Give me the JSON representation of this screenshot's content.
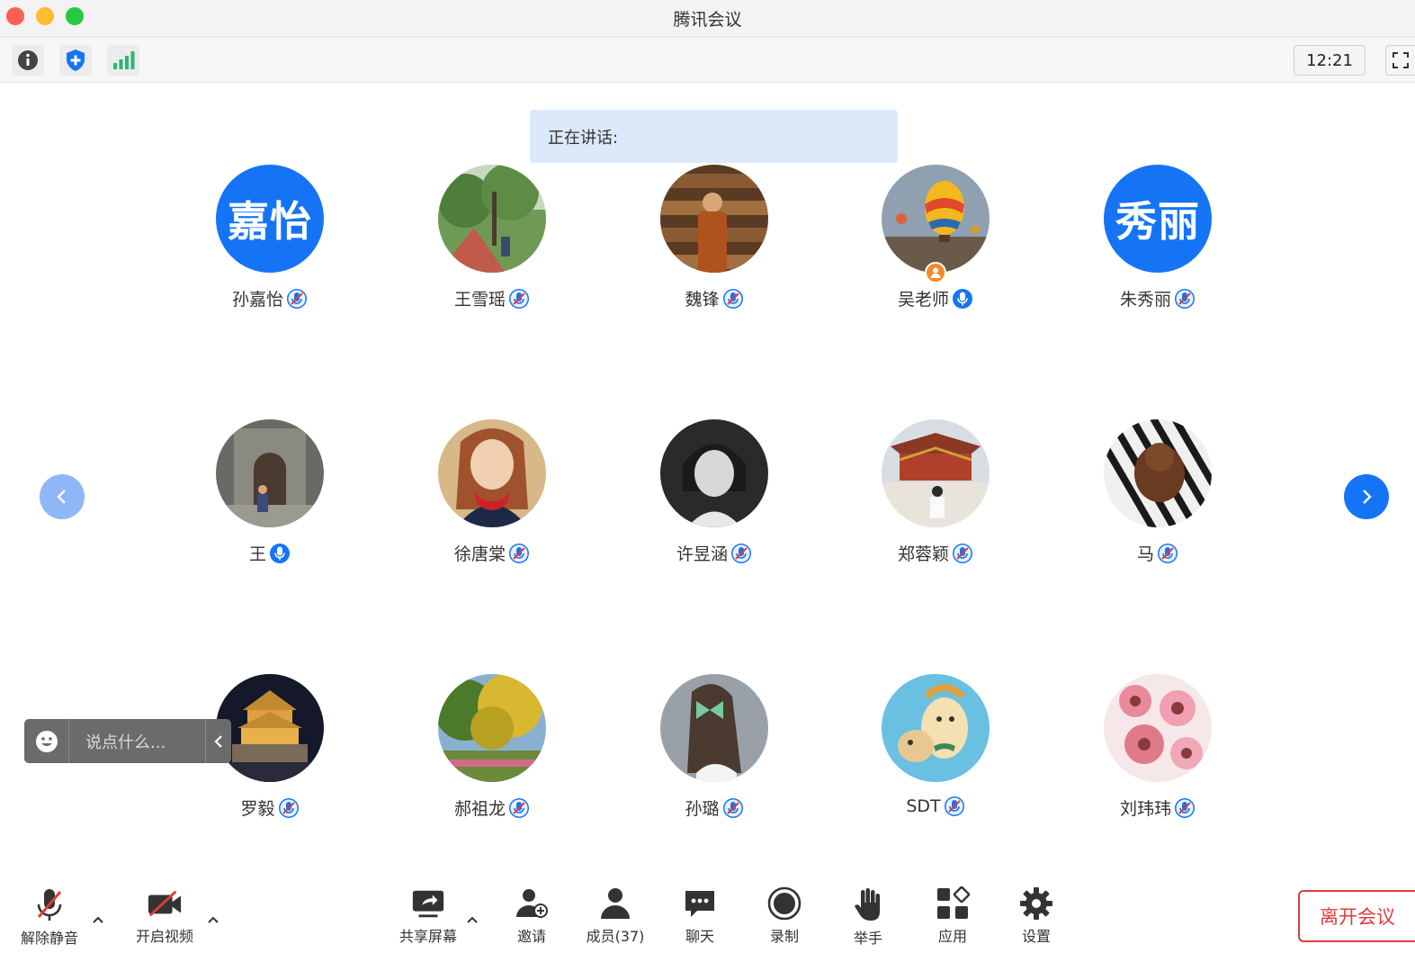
{
  "window": {
    "title": "腾讯会议"
  },
  "infobar": {
    "clock": "12:21"
  },
  "speaking": {
    "label": "正在讲话:"
  },
  "participants": [
    {
      "name": "孙嘉怡",
      "avatar_text": "嘉怡",
      "mic": "muted"
    },
    {
      "name": "王雪瑶",
      "avatar_text": "",
      "mic": "muted"
    },
    {
      "name": "魏锋",
      "avatar_text": "",
      "mic": "muted"
    },
    {
      "name": "吴老师",
      "avatar_text": "",
      "mic": "on",
      "host": true
    },
    {
      "name": "朱秀丽",
      "avatar_text": "秀丽",
      "mic": "muted"
    },
    {
      "name": "王",
      "avatar_text": "",
      "mic": "on"
    },
    {
      "name": "徐唐棠",
      "avatar_text": "",
      "mic": "muted"
    },
    {
      "name": "许昱涵",
      "avatar_text": "",
      "mic": "muted"
    },
    {
      "name": "郑蓉颖",
      "avatar_text": "",
      "mic": "muted"
    },
    {
      "name": "马",
      "avatar_text": "",
      "mic": "muted"
    },
    {
      "name": "罗毅",
      "avatar_text": "",
      "mic": "muted"
    },
    {
      "name": "郝祖龙",
      "avatar_text": "",
      "mic": "muted"
    },
    {
      "name": "孙璐",
      "avatar_text": "",
      "mic": "muted"
    },
    {
      "name": "SDT",
      "avatar_text": "",
      "mic": "muted"
    },
    {
      "name": "刘玮玮",
      "avatar_text": "",
      "mic": "muted"
    }
  ],
  "chat": {
    "placeholder": "说点什么..."
  },
  "toolbar": {
    "unmute": "解除静音",
    "video": "开启视频",
    "share": "共享屏幕",
    "invite": "邀请",
    "members": "成员(37)",
    "chat": "聊天",
    "record": "录制",
    "raise_hand": "举手",
    "apps": "应用",
    "settings": "设置",
    "leave": "离开会议"
  },
  "colors": {
    "accent": "#1574f6",
    "leave": "#e03c3c",
    "speaking_bg": "#dbe9fb"
  }
}
